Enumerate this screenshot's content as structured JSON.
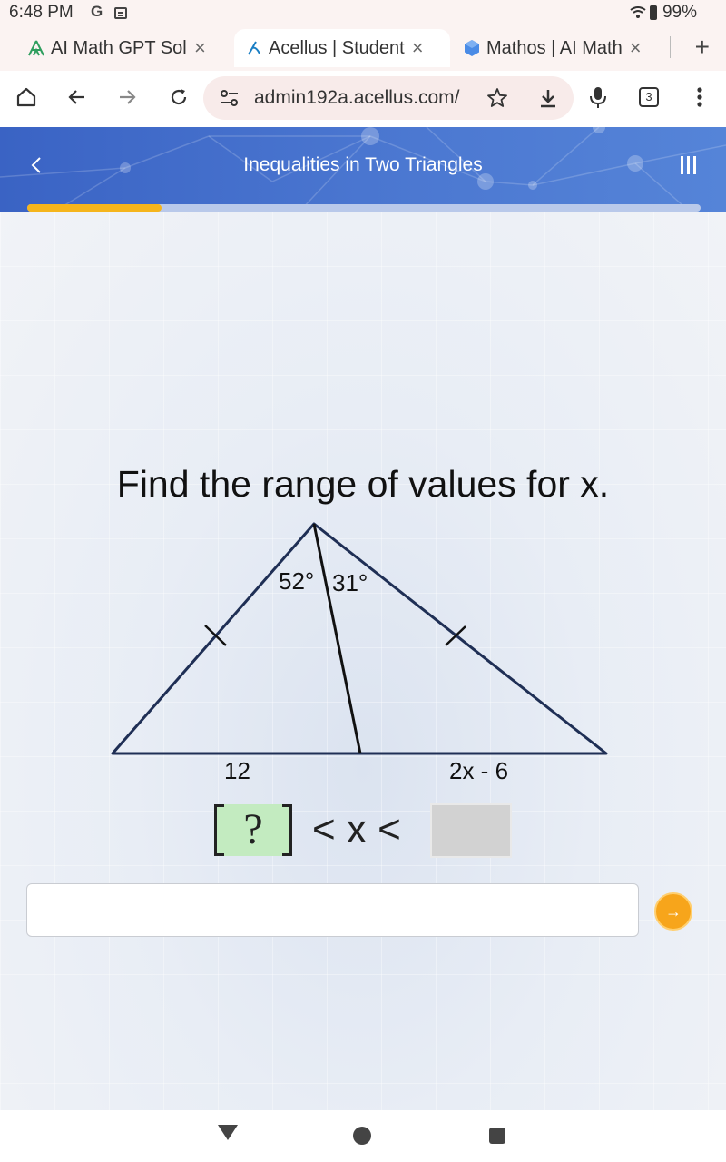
{
  "status": {
    "time": "6:48 PM",
    "g": "G",
    "battery": "99%"
  },
  "tabs": [
    {
      "label": "AI Math GPT Solv",
      "close": "×"
    },
    {
      "label": "Acellus | Student",
      "close": "×"
    },
    {
      "label": "Mathos | AI Math",
      "close": "×"
    }
  ],
  "new_tab": "+",
  "toolbar": {
    "url": "admin192a.acellus.com/",
    "tab_count": "3"
  },
  "header": {
    "title": "Inequalities in Two Triangles",
    "progress": 0.2
  },
  "problem": {
    "question": "Find the range of values for x.",
    "angle_left": "52°",
    "angle_right": "31°",
    "side_left": "12",
    "side_right": "2x - 6",
    "answer_placeholder": "?",
    "inequality": "< x <"
  },
  "input": {
    "value": "",
    "placeholder": ""
  },
  "submit": {
    "label": "→"
  },
  "colors": {
    "header": "#4a76d0",
    "progress": "#f5b51c",
    "answer_left": "#c3ebc0",
    "answer_right": "#d2d2d2",
    "submit": "#f7a51b",
    "triangle": "#1f2f55"
  }
}
